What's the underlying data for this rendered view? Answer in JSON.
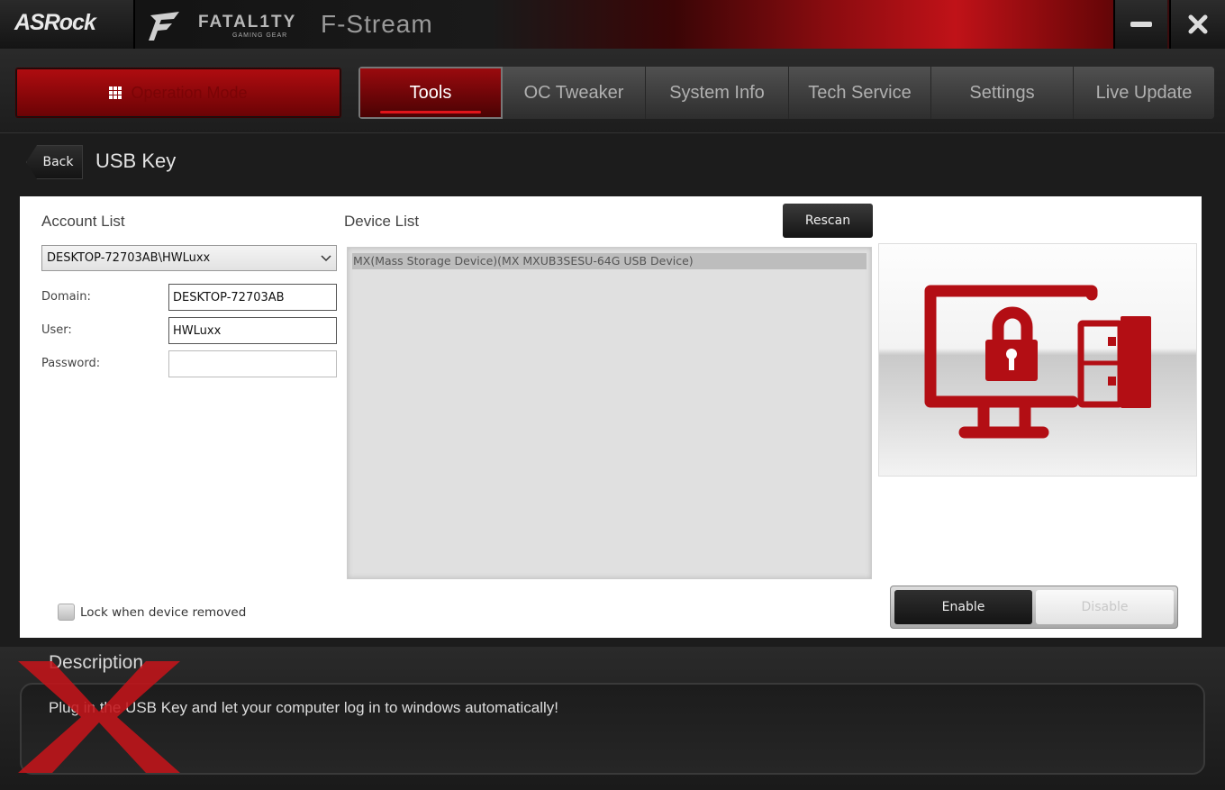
{
  "titlebar": {
    "brand": "ASRock",
    "series_brand": "FATAL1TY",
    "series_sub": "GAMING GEAR",
    "app_name": "F-Stream",
    "minimize_icon": "minimize-icon",
    "close_icon": "close-icon"
  },
  "nav": {
    "operation_mode": "Operation Mode",
    "tabs": [
      {
        "label": "Tools",
        "active": true
      },
      {
        "label": "OC Tweaker",
        "active": false
      },
      {
        "label": "System Info",
        "active": false
      },
      {
        "label": "Tech Service",
        "active": false
      },
      {
        "label": "Settings",
        "active": false
      },
      {
        "label": "Live Update",
        "active": false
      }
    ]
  },
  "page": {
    "back_label": "Back",
    "title": "USB Key"
  },
  "account": {
    "heading": "Account List",
    "selected": "DESKTOP-72703AB\\HWLuxx",
    "domain_label": "Domain:",
    "domain_value": "DESKTOP-72703AB",
    "user_label": "User:",
    "user_value": "HWLuxx",
    "password_label": "Password:",
    "password_value": ""
  },
  "device": {
    "heading": "Device List",
    "rescan_label": "Rescan",
    "items": [
      "MX(Mass Storage Device)(MX MXUB3SESU-64G USB Device)"
    ]
  },
  "lock_when_removed": {
    "label": "Lock when device removed",
    "checked": false
  },
  "toggle": {
    "enable_label": "Enable",
    "disable_label": "Disable",
    "selected": "Enable"
  },
  "description": {
    "title": "Description",
    "text": "Plug in the USB Key and let your computer log in to windows automatically!"
  },
  "colors": {
    "accent": "#c0141a",
    "icon_red": "#b30e14",
    "panel_bg": "#ffffff"
  }
}
